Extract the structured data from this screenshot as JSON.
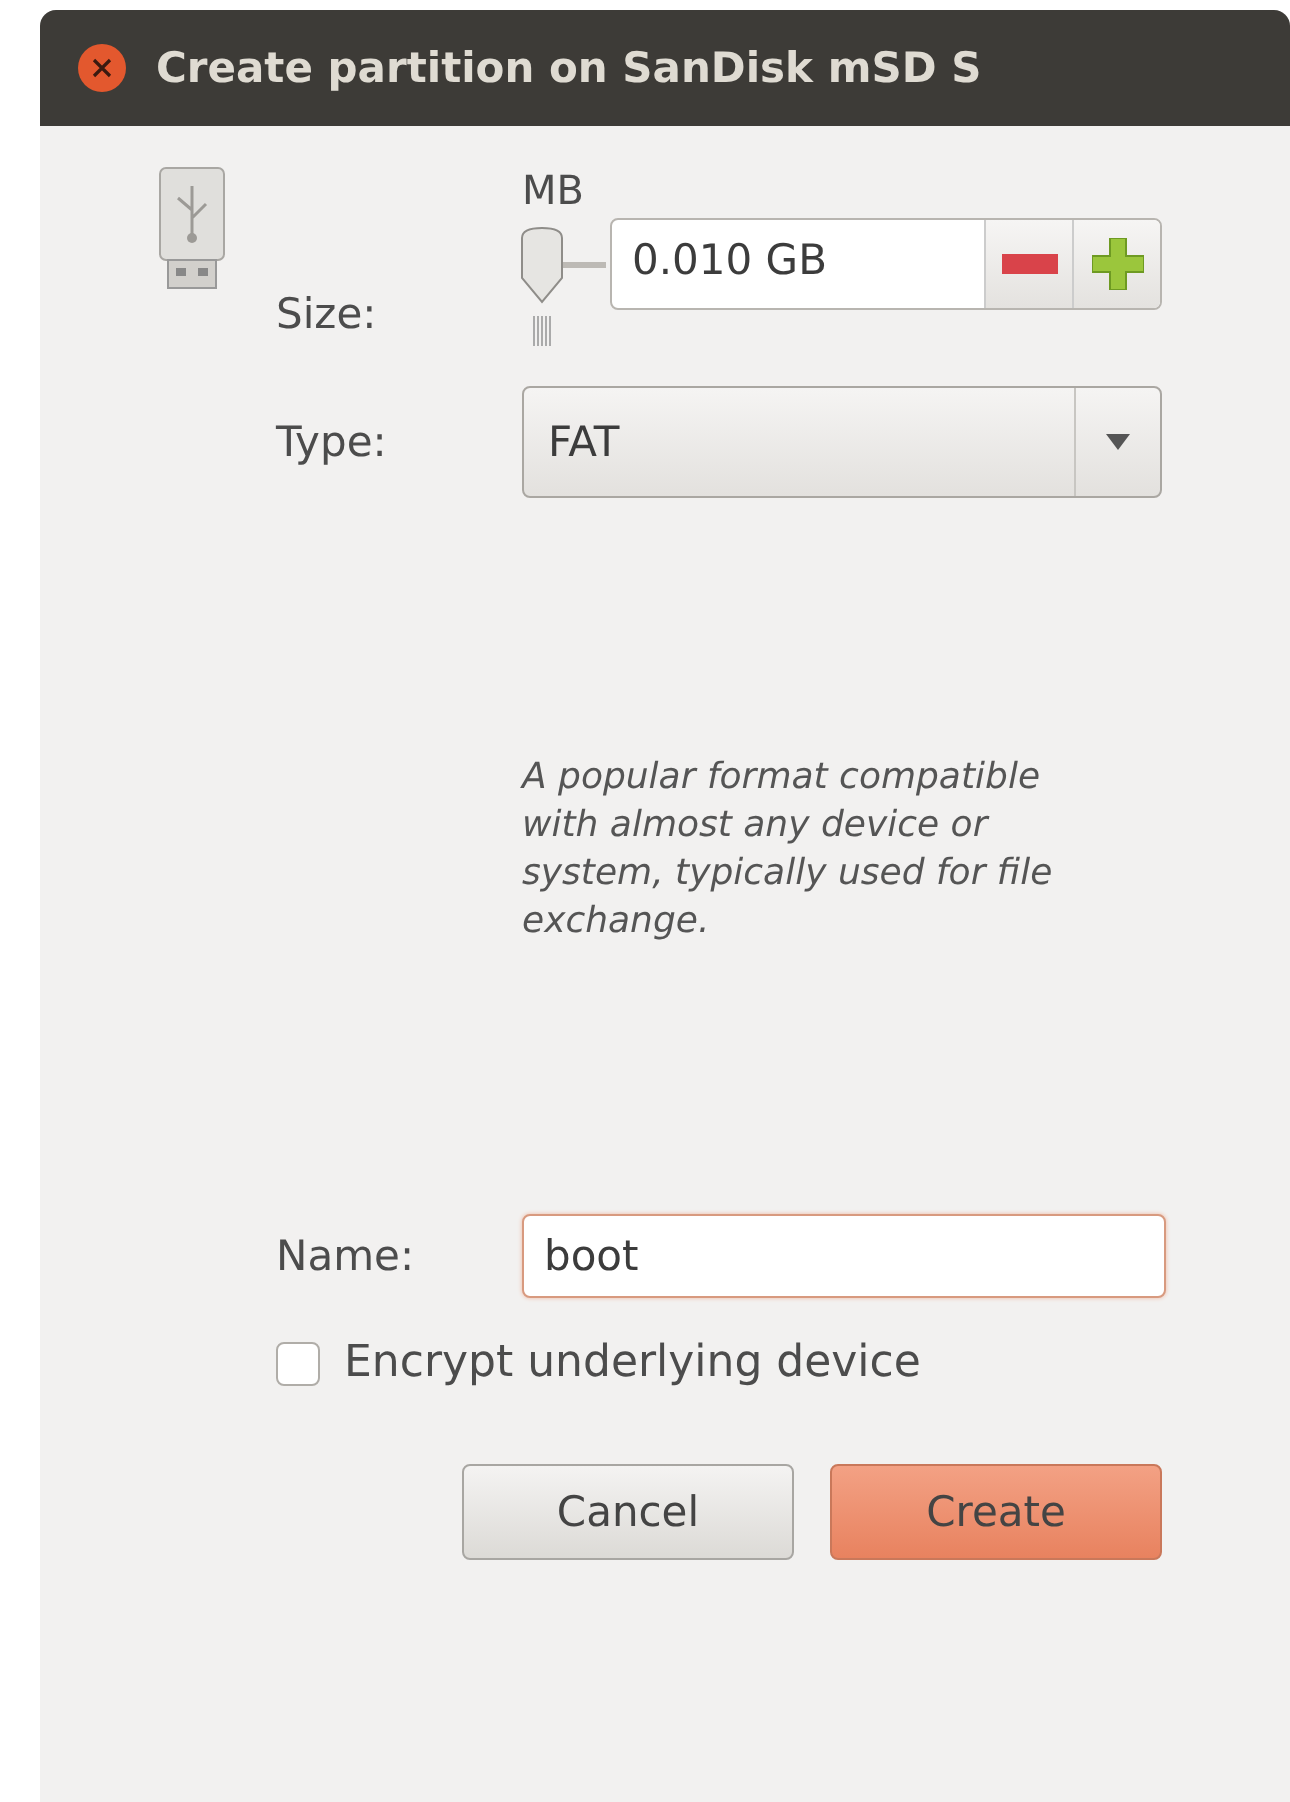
{
  "window": {
    "title": "Create partition on SanDisk mSD S"
  },
  "size": {
    "label": "Size:",
    "unit": "MB",
    "level": 0,
    "value": "0.010 GB"
  },
  "type": {
    "label": "Type:",
    "value": "FAT",
    "description": "A popular format compatible with almost any device or system, typically used for file exchange."
  },
  "name": {
    "label": "Name:",
    "value": "boot"
  },
  "encrypt": {
    "label": "Encrypt underlying device",
    "checked": false
  },
  "buttons": [
    {
      "label": "Cancel",
      "kind": "secondary"
    },
    {
      "label": "Create",
      "kind": "primary"
    }
  ]
}
